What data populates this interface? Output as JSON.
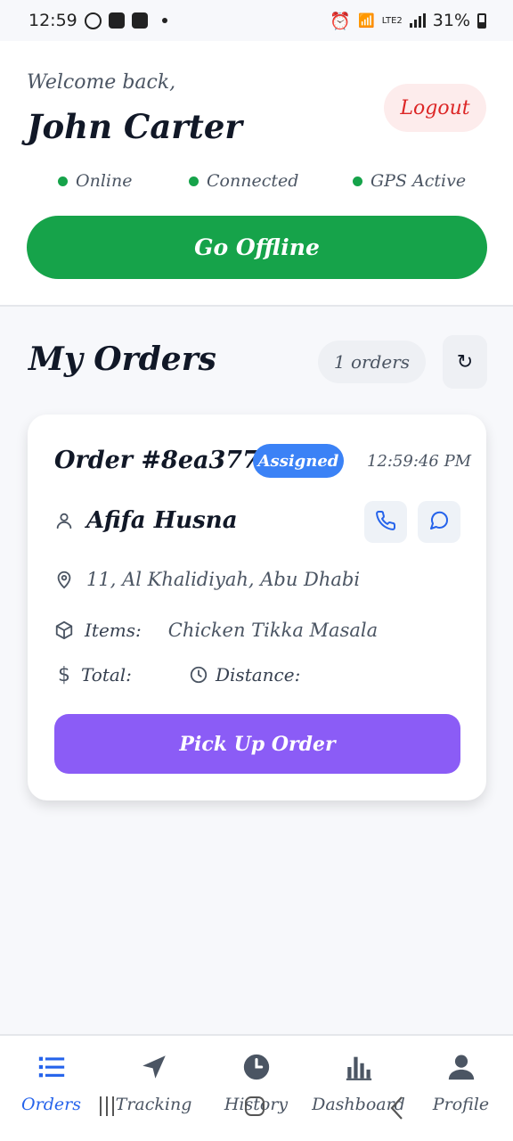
{
  "status_bar": {
    "time": "12:59",
    "battery": "31%",
    "network": "LTE2"
  },
  "header": {
    "welcome": "Welcome back,",
    "user_name": "John Carter",
    "logout_label": "Logout",
    "statuses": [
      "Online",
      "Connected",
      "GPS Active"
    ],
    "go_offline_label": "Go Offline"
  },
  "orders": {
    "title": "My Orders",
    "count_label": "1 orders",
    "refresh_icon": "↻",
    "items": [
      {
        "order_id": "Order #8ea377",
        "status": "Assigned",
        "time": "12:59:46 PM",
        "customer": "Afifa Husna",
        "address": "11, Al Khalidiyah, Abu Dhabi",
        "items_label": "Items:",
        "items_value": "Chicken Tikka Masala",
        "total_label": "Total:",
        "distance_label": "Distance:",
        "action_label": "Pick Up Order"
      }
    ]
  },
  "bottom_nav": {
    "items": [
      {
        "label": "Orders",
        "icon": "list-icon",
        "active": true
      },
      {
        "label": "Tracking",
        "icon": "navigation-icon",
        "active": false
      },
      {
        "label": "History",
        "icon": "clock-icon",
        "active": false
      },
      {
        "label": "Dashboard",
        "icon": "bar-chart-icon",
        "active": false
      },
      {
        "label": "Profile",
        "icon": "user-icon",
        "active": false
      }
    ]
  },
  "colors": {
    "accent_green": "#16a34a",
    "badge_blue": "#3b82f6",
    "action_purple": "#8b5cf6",
    "logout_red": "#dc2626",
    "nav_active": "#2563eb"
  }
}
